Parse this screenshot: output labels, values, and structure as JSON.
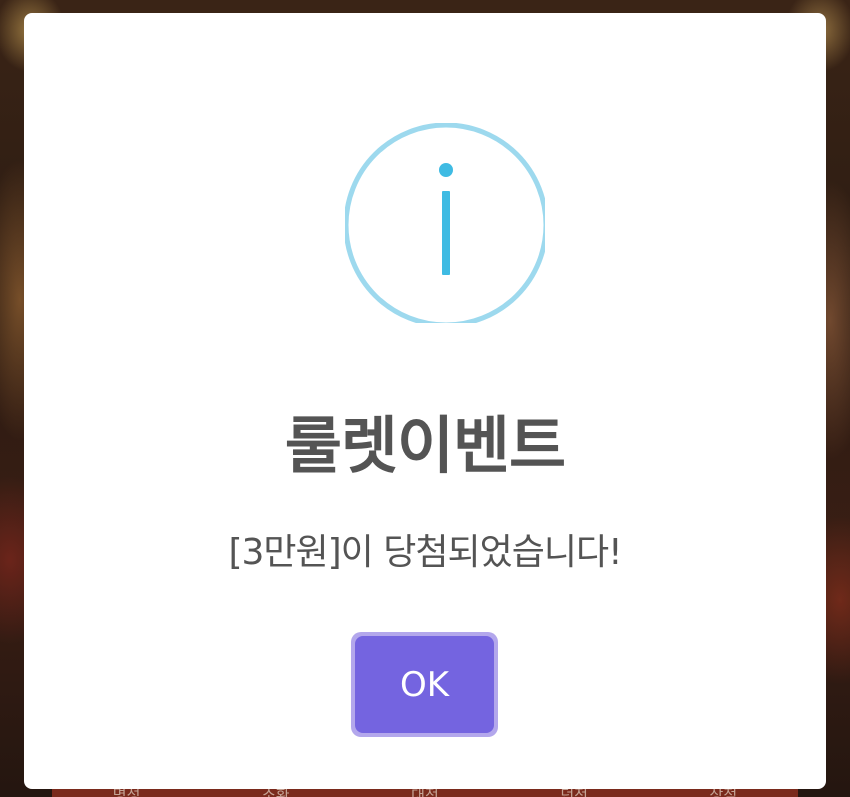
{
  "dialog": {
    "icon": "info-icon",
    "title": "룰렛이벤트",
    "message": "[3만원]이 당첨되었습니다!",
    "ok_label": "OK"
  },
  "colors": {
    "icon_ring": "#9dd9ee",
    "icon_glyph": "#3fbbe3",
    "title_text": "#545454",
    "ok_button": "#7464e0",
    "ok_button_outline": "#b3a7ec"
  },
  "background_nav": {
    "items": [
      "명성",
      "소환",
      "대전",
      "던전",
      "상점"
    ]
  }
}
